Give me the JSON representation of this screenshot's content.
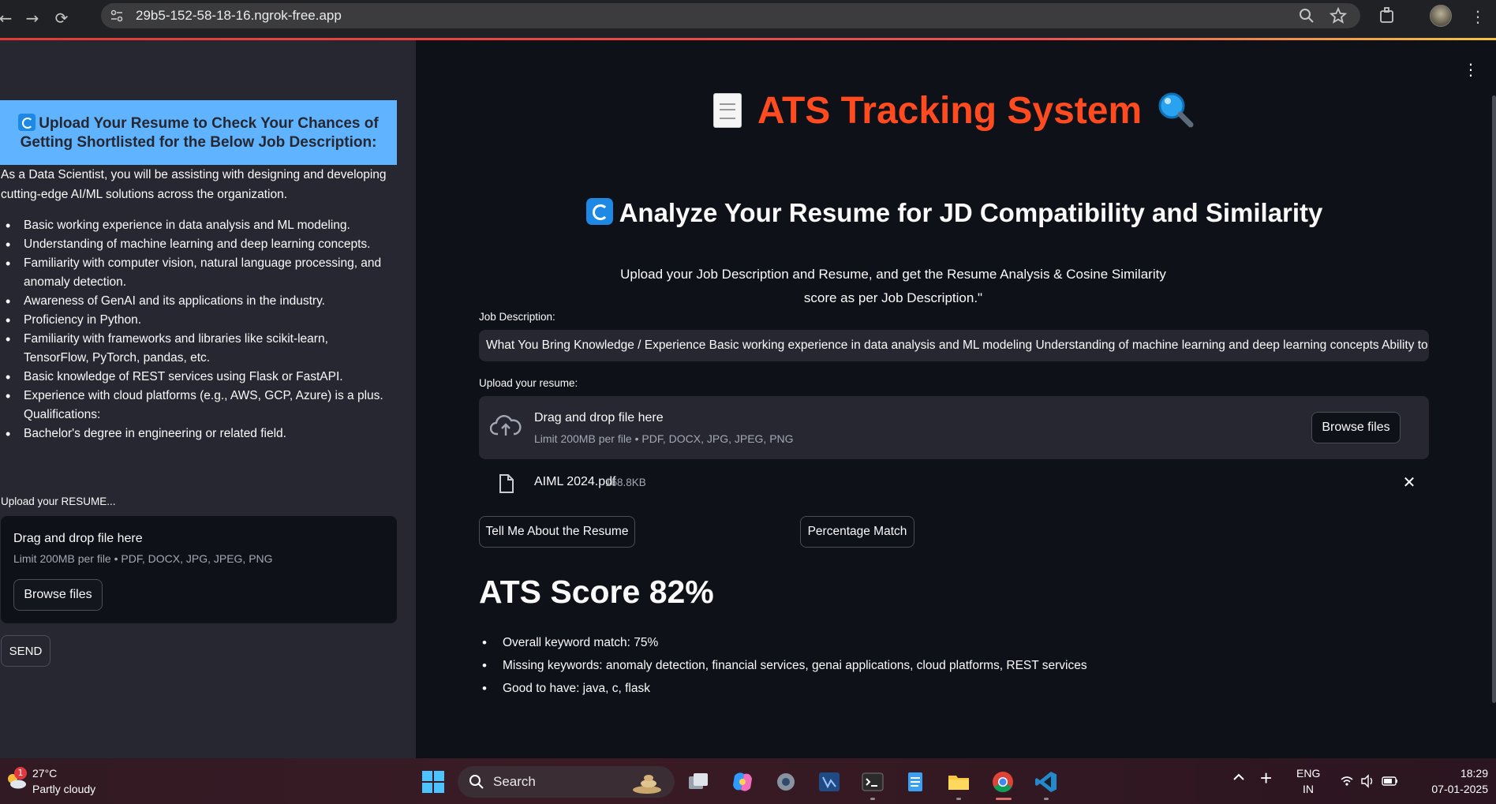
{
  "browser": {
    "url": "29b5-152-58-18-16.ngrok-free.app"
  },
  "sidebar": {
    "banner_text": "Upload Your Resume to Check Your Chances of Getting Shortlisted for the Below Job Description:",
    "intro": "As a Data Scientist, you will be assisting with designing and developing cutting-edge AI/ML solutions across the organization.",
    "requirements": [
      "Basic working experience in data analysis and ML modeling.",
      "Understanding of machine learning and deep learning concepts.",
      "Familiarity with computer vision, natural language processing, and anomaly detection.",
      "Awareness of GenAI and its applications in the industry.",
      "Proficiency in Python.",
      "Familiarity with frameworks and libraries like scikit-learn, TensorFlow, PyTorch, pandas, etc.",
      "Basic knowledge of REST services using Flask or FastAPI.",
      "Experience with cloud platforms (e.g., AWS, GCP, Azure) is a plus. Qualifications:",
      "Bachelor's degree in engineering or related field."
    ],
    "upload_label": "Upload your RESUME...",
    "drop_title": "Drag and drop file here",
    "drop_limit": "Limit 200MB per file • PDF, DOCX, JPG, JPEG, PNG",
    "browse_label": "Browse files",
    "send_label": "SEND"
  },
  "main": {
    "title": "ATS Tracking System",
    "subtitle": "Analyze Your Resume for JD Compatibility and Similarity",
    "intro": "Upload your Job Description and Resume, and get the Resume Analysis & Cosine Similarity score as per Job Description.\"",
    "jd_label": "Job Description:",
    "jd_value": "What You Bring  Knowledge / Experience  Basic working experience in data analysis and ML modeling Understanding of machine learning and deep learning concepts Ability to assis",
    "upload_label": "Upload your resume:",
    "drop_title": "Drag and drop file here",
    "drop_limit": "Limit 200MB per file • PDF, DOCX, JPG, JPEG, PNG",
    "browse_label": "Browse files",
    "uploaded_file": {
      "name": "AIML 2024.pdf",
      "size": "168.8KB"
    },
    "tell_button": "Tell Me About the Resume",
    "percentage_button": "Percentage Match",
    "score_heading": "ATS Score 82%",
    "score_points": [
      "Overall keyword match: 75%",
      "Missing keywords: anomaly detection, financial services, genai applications, cloud platforms, REST services",
      "Good to have: java, c, flask"
    ]
  },
  "taskbar": {
    "weather_badge": "1",
    "temperature": "27°C",
    "condition": "Partly cloudy",
    "search_label": "Search",
    "lang_line1": "ENG",
    "lang_line2": "IN",
    "time": "18:29",
    "date": "07-01-2025"
  },
  "colors": {
    "title_accent": "#ff4b1f",
    "banner_bg": "#60b4ff",
    "sidebar_bg": "#262730",
    "main_bg": "#0e1117"
  }
}
